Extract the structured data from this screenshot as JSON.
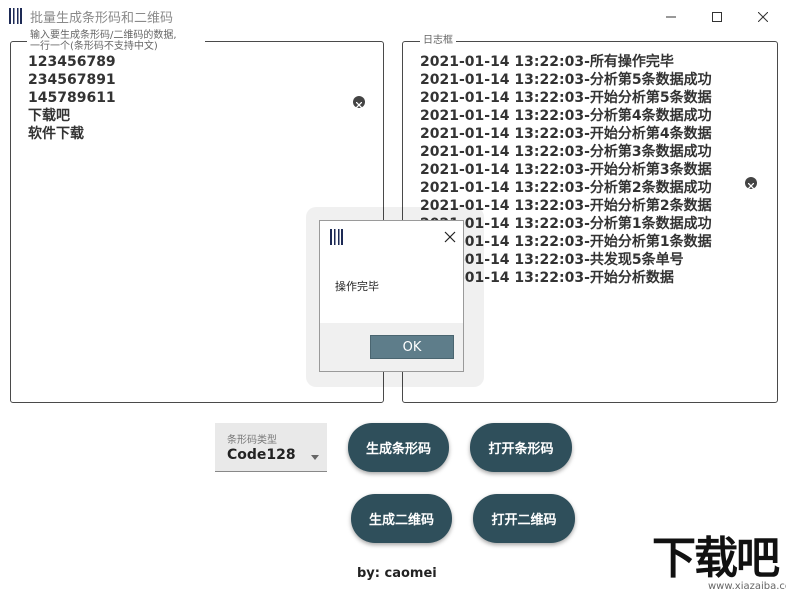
{
  "window": {
    "title": "批量生成条形码和二维码",
    "minimize_icon": "minimize-icon",
    "maximize_icon": "maximize-icon",
    "close_icon": "close-icon"
  },
  "input_panel": {
    "legend_line1": "输入要生成条形码/二维码的数据,",
    "legend_line2": "一行一个(条形码不支持中文)",
    "lines": [
      "123456789",
      "234567891",
      "145789611",
      "下载吧",
      "软件下载"
    ]
  },
  "log_panel": {
    "legend": "日志框",
    "lines": [
      "2021-01-14 13:22:03-所有操作完毕",
      "2021-01-14 13:22:03-分析第5条数据成功",
      "2021-01-14 13:22:03-开始分析第5条数据",
      "2021-01-14 13:22:03-分析第4条数据成功",
      "2021-01-14 13:22:03-开始分析第4条数据",
      "2021-01-14 13:22:03-分析第3条数据成功",
      "2021-01-14 13:22:03-开始分析第3条数据",
      "2021-01-14 13:22:03-分析第2条数据成功",
      "2021-01-14 13:22:03-开始分析第2条数据",
      "2021-01-14 13:22:03-分析第1条数据成功",
      "2021-01-14 13:22:03-开始分析第1条数据",
      "2021-01-14 13:22:03-共发现5条单号",
      "2021-01-14 13:22:03-开始分析数据"
    ]
  },
  "dialog": {
    "message": "操作完毕",
    "ok_label": "OK"
  },
  "barcode_type": {
    "label": "条形码类型",
    "value": "Code128"
  },
  "buttons": {
    "generate_barcode": "生成条形码",
    "open_barcode": "打开条形码",
    "generate_qrcode": "生成二维码",
    "open_qrcode": "打开二维码"
  },
  "author": "by: caomei",
  "watermark": {
    "text": "下载吧",
    "url": "www.xiazaiba.com"
  },
  "colors": {
    "button_bg": "#2f4f5b",
    "ok_button_bg": "#5e7d8a"
  }
}
